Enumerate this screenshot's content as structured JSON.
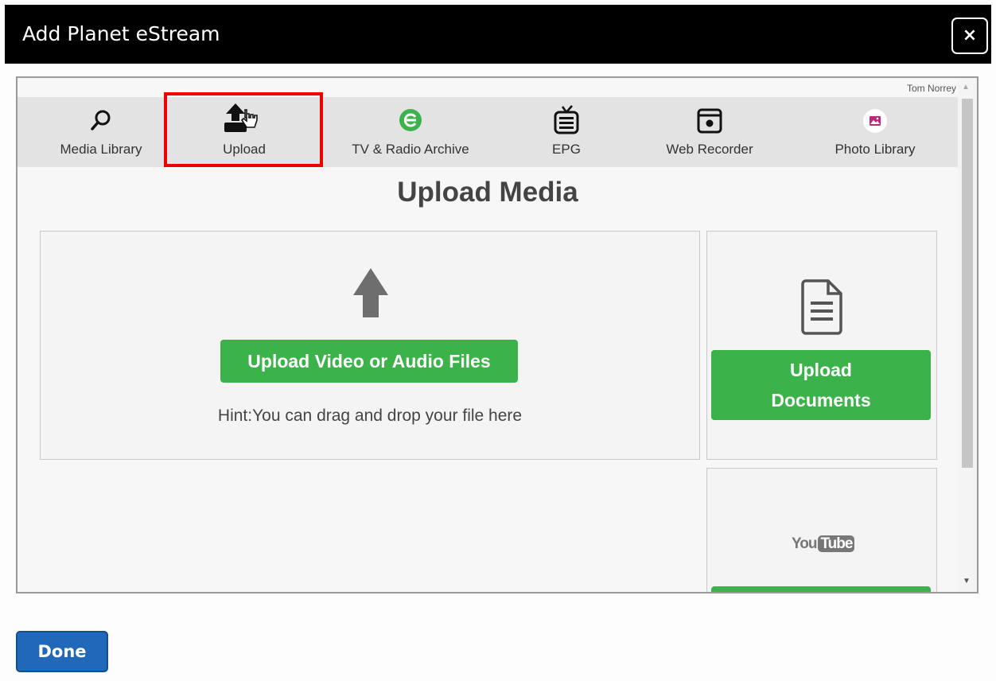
{
  "window": {
    "title": "Add Planet eStream",
    "close_label": "×"
  },
  "user": {
    "name": "Tom Norrey"
  },
  "nav": {
    "items": [
      {
        "label": "Media Library",
        "icon": "search-icon"
      },
      {
        "label": "Upload",
        "icon": "upload-icon"
      },
      {
        "label": "TV & Radio Archive",
        "icon": "archive-icon"
      },
      {
        "label": "EPG",
        "icon": "tv-icon"
      },
      {
        "label": "Web Recorder",
        "icon": "recorder-icon"
      },
      {
        "label": "Photo Library",
        "icon": "photo-icon"
      }
    ],
    "highlighted": "Upload"
  },
  "main": {
    "heading": "Upload Media",
    "upload_media_button": "Upload Video or Audio Files",
    "hint": "Hint:You can drag and drop your file here",
    "upload_documents_line1": "Upload",
    "upload_documents_line2": "Documents",
    "youtube_you": "You",
    "youtube_tube": "Tube"
  },
  "footer": {
    "done_label": "Done"
  },
  "colors": {
    "accent_green": "#3cb34a",
    "done_blue": "#2169b8",
    "highlight_red": "#ee0000"
  }
}
